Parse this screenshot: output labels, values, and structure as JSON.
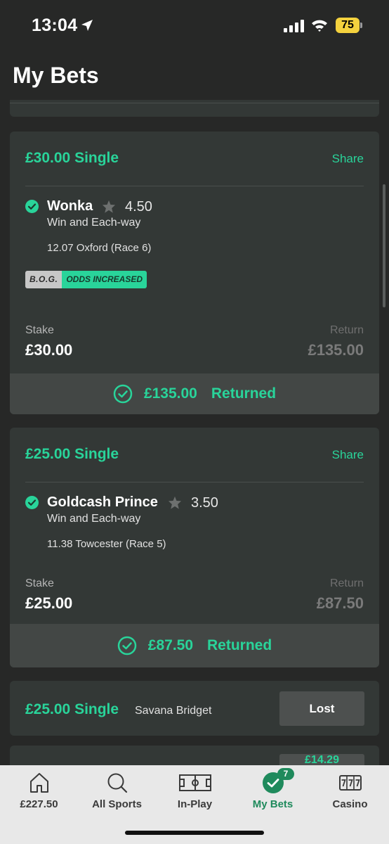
{
  "status_bar": {
    "time": "13:04",
    "battery": "75"
  },
  "page": {
    "title": "My Bets"
  },
  "bets": [
    {
      "title": "£30.00 Single",
      "share_label": "Share",
      "selection": "Wonka",
      "odds": "4.50",
      "market": "Win and Each-way",
      "event": "12.07 Oxford (Race 6)",
      "badges": {
        "bog": "B.O.G.",
        "odds_increased": "ODDS INCREASED"
      },
      "stake_label": "Stake",
      "stake": "£30.00",
      "return_label": "Return",
      "return": "£135.00",
      "returned_amount": "£135.00",
      "returned_label": "Returned"
    },
    {
      "title": "£25.00 Single",
      "share_label": "Share",
      "selection": "Goldcash Prince",
      "odds": "3.50",
      "market": "Win and Each-way",
      "event": "11.38 Towcester (Race 5)",
      "stake_label": "Stake",
      "stake": "£25.00",
      "return_label": "Return",
      "return": "£87.50",
      "returned_amount": "£87.50",
      "returned_label": "Returned"
    },
    {
      "title": "£25.00 Single",
      "selection": "Savana Bridget",
      "status": "Lost"
    },
    {
      "partial_value": "£14.29"
    }
  ],
  "tab_bar": {
    "tabs": [
      {
        "label": "£227.50",
        "icon": "home-icon"
      },
      {
        "label": "All Sports",
        "icon": "search-icon"
      },
      {
        "label": "In-Play",
        "icon": "pitch-icon"
      },
      {
        "label": "My Bets",
        "icon": "check-circle-icon",
        "badge": "7",
        "active": true
      },
      {
        "label": "Casino",
        "icon": "slot-machine-icon"
      }
    ]
  },
  "colors": {
    "accent": "#29d49a",
    "active_tab": "#1f8a5c",
    "card": "#333836",
    "background": "#272827"
  }
}
